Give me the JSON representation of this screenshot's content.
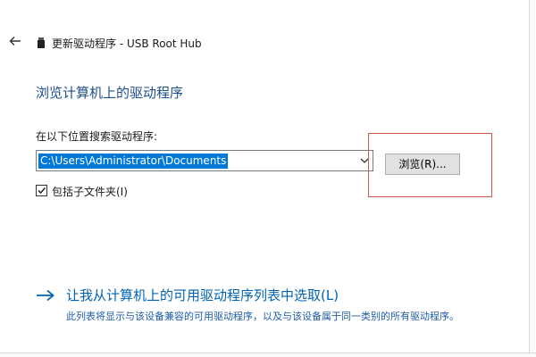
{
  "header": {
    "title": "更新驱动程序 - USB Root Hub"
  },
  "page": {
    "heading": "浏览计算机上的驱动程序",
    "search_label": "在以下位置搜索驱动程序:",
    "path_value": "C:\\Users\\Administrator\\Documents",
    "browse_label": "浏览(R)...",
    "include_subfolders_label": "包括子文件夹(I)",
    "include_subfolders_checked": true
  },
  "option": {
    "title": "让我从计算机上的可用驱动程序列表中选取(L)",
    "description": "此列表将显示与该设备兼容的可用驱动程序，以及与该设备属于同一类别的所有驱动程序。"
  },
  "icons": {
    "back": "back-arrow-icon",
    "device": "usb-device-icon",
    "dropdown": "chevron-down-icon",
    "option_arrow": "right-arrow-icon",
    "checkmark": "check-icon"
  },
  "colors": {
    "heading": "#1e4e8c",
    "link": "#0063b1",
    "selection": "#0078d7",
    "highlight": "#d9534f"
  }
}
